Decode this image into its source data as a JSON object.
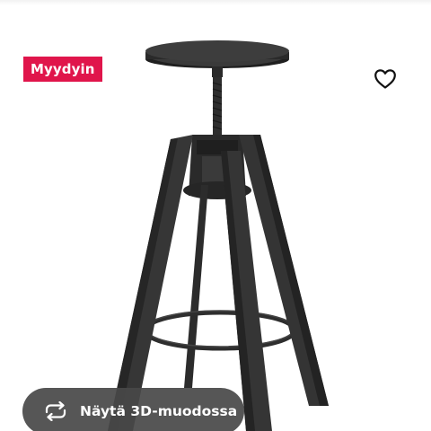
{
  "badge": {
    "label": "Myydyin",
    "color": "#e0154b"
  },
  "favorite": {
    "icon": "heart-outline-icon"
  },
  "view_3d": {
    "label": "Näytä 3D-muodossa",
    "icon": "rotate-arrows-icon"
  },
  "product": {
    "image": "black bar stool with swivel screw seat and four splayed legs with footring",
    "colors": {
      "stool": "#2f2f2f",
      "stool_dark": "#1c1c1c",
      "badge": "#e0154b",
      "overlay_button": "#484848"
    }
  }
}
